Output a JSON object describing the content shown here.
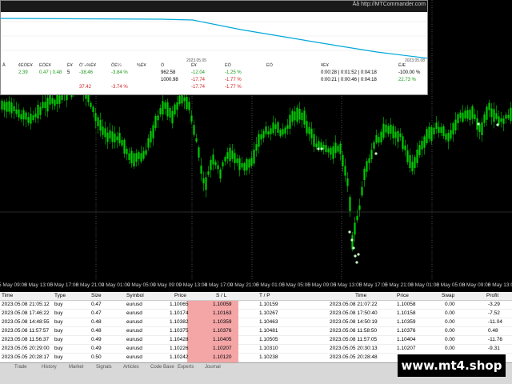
{
  "panel": {
    "tabs": [
      "",
      "",
      "",
      "",
      "",
      "",
      ""
    ],
    "credit": "Åå http://MTCommander.com",
    "date_labels": [
      "2023.05.05",
      "2023.05.08"
    ],
    "stats_headers": [
      "Å",
      "¢ÉÖÉ¥",
      "ÉÖÉ¥",
      "Ê¥",
      "Ö¨¬%Ê¥",
      "ÔÉ¼",
      "%Ê¥",
      "Ö",
      "Ê¥",
      "ÉÖ",
      "ÉÖ",
      "¥Ê¥",
      "ËÆ"
    ],
    "rows": [
      [
        "2.39",
        "0.47 | 0.48",
        "5",
        "-38.46",
        "-3.84 %",
        "",
        "962.58",
        "-12.04",
        "-1.25 %",
        "",
        "",
        "0:00:28 | 0:01:52 | 0:04:18",
        "-100.00 %"
      ],
      [
        "",
        "",
        "",
        "",
        "",
        "",
        "1000.98",
        "-17.74",
        "-1.77 %",
        "",
        "",
        "0:00:21 | 0:00:46 | 0:04:18",
        "22.73 %"
      ],
      [
        "",
        "",
        "",
        "37.42",
        "-3.74 %",
        "",
        "",
        "-17.74",
        "-1.77 %",
        "",
        "",
        "",
        ""
      ]
    ]
  },
  "colors": {
    "candle": "#00cc00",
    "equity_line": "#00a8d8",
    "sl_cell": "#f4a6a6",
    "green_text": "#1a9a1a",
    "red_text": "#d02020"
  },
  "xaxis": {
    "labels": [
      "5 May 09:00",
      "8 May 13:00",
      "5 May 17:00",
      "8 May 21:00",
      "9 May 01:00",
      "9 May 05:00",
      "9 May 09:00",
      "9 May 13:00",
      "4 May 17:00",
      "9 May 21:00",
      "5 May 01:00",
      "5 May 05:00",
      "5 May 09:00",
      "5 May 13:00",
      "5 May 17:00",
      "5 May 21:00",
      "8 May 01:00",
      "8 May 05:00",
      "8 May 09:00",
      "8 May 13:00"
    ]
  },
  "grid": {
    "headers": [
      "Time",
      "Type",
      "Size",
      "Symbol",
      "Price",
      "S / L",
      "T / P",
      "Time",
      "Price",
      "Swap",
      "Profit"
    ],
    "rows": [
      [
        "2023.05.08 21:05:12",
        "buy",
        "0.47",
        "eurusd",
        "1.10065",
        "1.10059",
        "1.10159",
        "2023.05.08 21:07:22",
        "1.10058",
        "0.00",
        "-3.29"
      ],
      [
        "2023.05.08 17:46:22",
        "buy",
        "0.47",
        "eurusd",
        "1.10174",
        "1.10163",
        "1.10267",
        "2023.05.08 17:50:40",
        "1.10158",
        "0.00",
        "-7.52"
      ],
      [
        "2023.05.08 14:48:55",
        "buy",
        "0.48",
        "eurusd",
        "1.10382",
        "1.10359",
        "1.10463",
        "2023.05.08 14:50:19",
        "1.10359",
        "0.00",
        "-11.04"
      ],
      [
        "2023.05.08 11:57:57",
        "buy",
        "0.48",
        "eurusd",
        "1.10375",
        "1.10376",
        "1.10481",
        "2023.05.08 11:58:50",
        "1.10376",
        "0.00",
        "0.48"
      ],
      [
        "2023.05.08 11:56:37",
        "buy",
        "0.49",
        "eurusd",
        "1.10428",
        "1.10405",
        "1.10505",
        "2023.05.08 11:57:05",
        "1.10404",
        "0.00",
        "-11.76"
      ],
      [
        "2023.05.05 20:29:00",
        "buy",
        "0.49",
        "eurusd",
        "1.10226",
        "1.10207",
        "1.10310",
        "2023.05.05 20:30:13",
        "1.10207",
        "0.00",
        "-9.31"
      ],
      [
        "2023.05.05 20:28:17",
        "buy",
        "0.50",
        "eurusd",
        "1.10242",
        "1.10120",
        "1.10238",
        "2023.05.05 20:28:48",
        "1.10238",
        "0.00",
        "-12.00"
      ]
    ]
  },
  "bottom_tabs": [
    "Trade",
    "History",
    "Market",
    "Signals",
    "Articles",
    "Code Base",
    "Experts",
    "Journal"
  ],
  "watermark": "www.mt4.shop"
}
